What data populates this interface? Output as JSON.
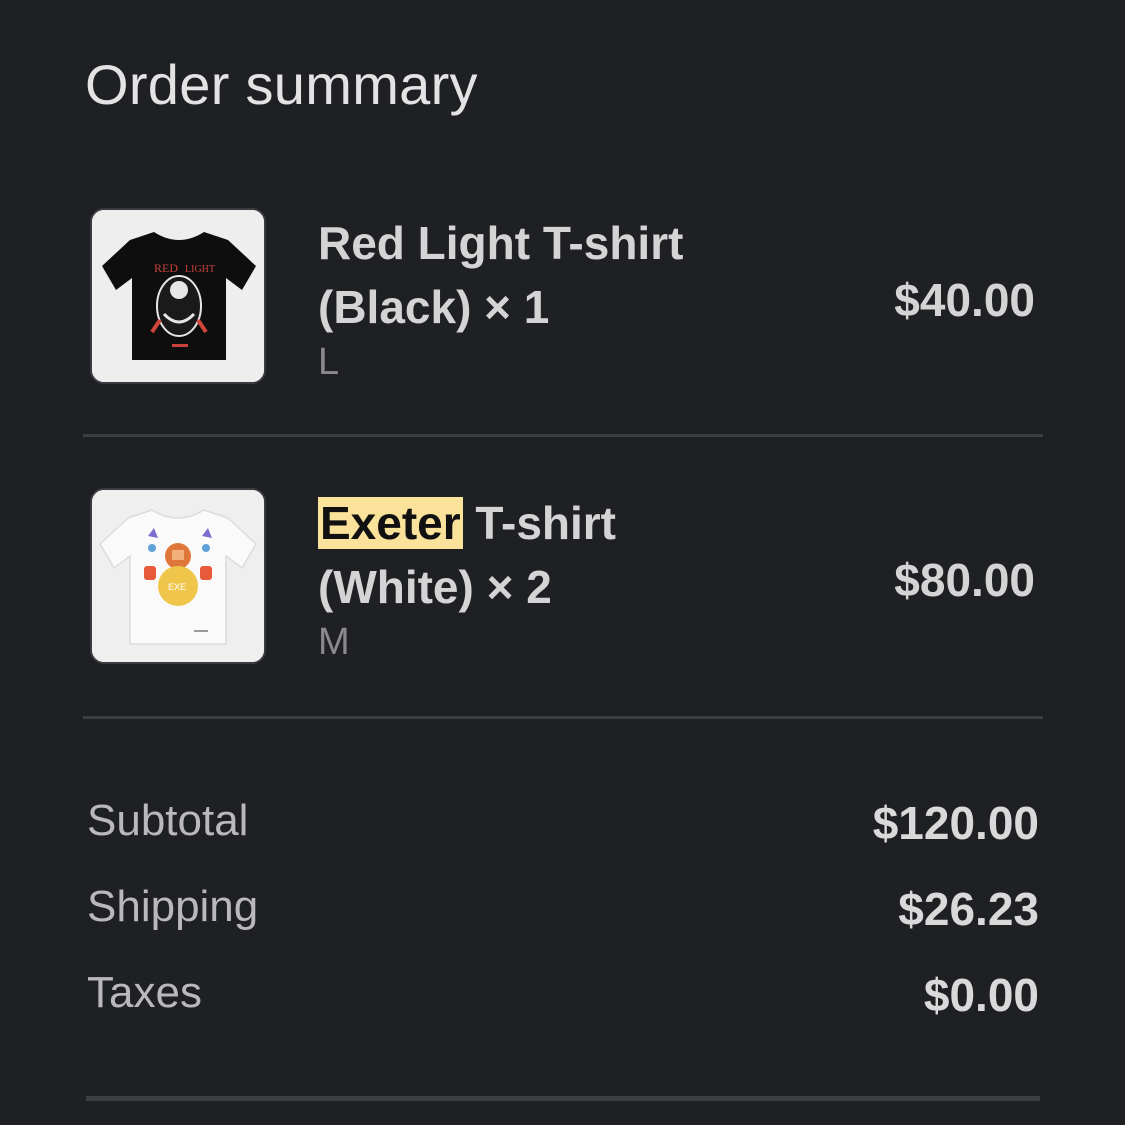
{
  "summary": {
    "title": "Order summary"
  },
  "items": [
    {
      "name_line1": "Red Light T-shirt",
      "name_line2": "(Black) × 1",
      "variant": "L",
      "price": "$40.00",
      "image": "black-tshirt-red-light-print"
    },
    {
      "name_highlight": "Exeter",
      "name_rest": " T-shirt",
      "name_line2": "(White) × 2",
      "variant": "M",
      "price": "$80.00",
      "image": "white-tshirt-exeter-print"
    }
  ],
  "totals": {
    "subtotal_label": "Subtotal",
    "subtotal_value": "$120.00",
    "shipping_label": "Shipping",
    "shipping_value": "$26.23",
    "taxes_label": "Taxes",
    "taxes_value": "$0.00"
  },
  "colors": {
    "background": "#1f2024",
    "highlight": "#fbe29a",
    "divider": "#3d3e43"
  }
}
